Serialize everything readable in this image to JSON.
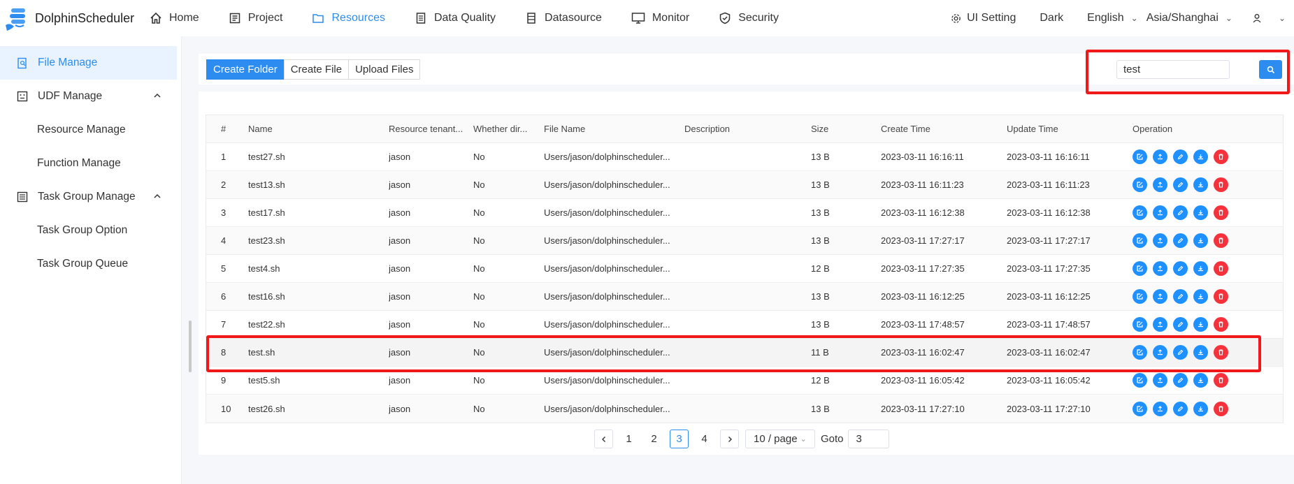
{
  "app": {
    "name": "DolphinScheduler"
  },
  "nav": {
    "items": [
      {
        "label": "Home",
        "icon": "home-icon"
      },
      {
        "label": "Project",
        "icon": "project-icon"
      },
      {
        "label": "Resources",
        "icon": "folder-icon",
        "active": true
      },
      {
        "label": "Data Quality",
        "icon": "data-quality-icon"
      },
      {
        "label": "Datasource",
        "icon": "datasource-icon"
      },
      {
        "label": "Monitor",
        "icon": "monitor-icon"
      },
      {
        "label": "Security",
        "icon": "shield-icon"
      }
    ],
    "right": {
      "ui_setting": "UI Setting",
      "theme": "Dark",
      "language": "English",
      "timezone": "Asia/Shanghai"
    }
  },
  "sidebar": {
    "items": [
      {
        "label": "File Manage",
        "icon": "file-search-icon"
      },
      {
        "label": "UDF Manage",
        "icon": "udf-icon"
      },
      {
        "label": "Resource Manage"
      },
      {
        "label": "Function Manage"
      },
      {
        "label": "Task Group Manage",
        "icon": "task-group-icon"
      },
      {
        "label": "Task Group Option"
      },
      {
        "label": "Task Group Queue"
      }
    ]
  },
  "toolbar": {
    "create_folder": "Create Folder",
    "create_file": "Create File",
    "upload_files": "Upload Files",
    "search_value": "test"
  },
  "table": {
    "columns": [
      "#",
      "Name",
      "Resource tenant...",
      "Whether dir...",
      "File Name",
      "Description",
      "Size",
      "Create Time",
      "Update Time",
      "Operation"
    ],
    "rows": [
      {
        "num": "1",
        "name": "test27.sh",
        "tenant": "jason",
        "dir": "No",
        "file": "Users/jason/dolphinscheduler...",
        "desc": "",
        "size": "13 B",
        "create": "2023-03-11 16:16:11",
        "update": "2023-03-11 16:16:11"
      },
      {
        "num": "2",
        "name": "test13.sh",
        "tenant": "jason",
        "dir": "No",
        "file": "Users/jason/dolphinscheduler...",
        "desc": "",
        "size": "13 B",
        "create": "2023-03-11 16:11:23",
        "update": "2023-03-11 16:11:23"
      },
      {
        "num": "3",
        "name": "test17.sh",
        "tenant": "jason",
        "dir": "No",
        "file": "Users/jason/dolphinscheduler...",
        "desc": "",
        "size": "13 B",
        "create": "2023-03-11 16:12:38",
        "update": "2023-03-11 16:12:38"
      },
      {
        "num": "4",
        "name": "test23.sh",
        "tenant": "jason",
        "dir": "No",
        "file": "Users/jason/dolphinscheduler...",
        "desc": "",
        "size": "13 B",
        "create": "2023-03-11 17:27:17",
        "update": "2023-03-11 17:27:17"
      },
      {
        "num": "5",
        "name": "test4.sh",
        "tenant": "jason",
        "dir": "No",
        "file": "Users/jason/dolphinscheduler...",
        "desc": "",
        "size": "12 B",
        "create": "2023-03-11 17:27:35",
        "update": "2023-03-11 17:27:35"
      },
      {
        "num": "6",
        "name": "test16.sh",
        "tenant": "jason",
        "dir": "No",
        "file": "Users/jason/dolphinscheduler...",
        "desc": "",
        "size": "13 B",
        "create": "2023-03-11 16:12:25",
        "update": "2023-03-11 16:12:25"
      },
      {
        "num": "7",
        "name": "test22.sh",
        "tenant": "jason",
        "dir": "No",
        "file": "Users/jason/dolphinscheduler...",
        "desc": "",
        "size": "13 B",
        "create": "2023-03-11 17:48:57",
        "update": "2023-03-11 17:48:57"
      },
      {
        "num": "8",
        "name": "test.sh",
        "tenant": "jason",
        "dir": "No",
        "file": "Users/jason/dolphinscheduler...",
        "desc": "",
        "size": "11 B",
        "create": "2023-03-11 16:02:47",
        "update": "2023-03-11 16:02:47"
      },
      {
        "num": "9",
        "name": "test5.sh",
        "tenant": "jason",
        "dir": "No",
        "file": "Users/jason/dolphinscheduler...",
        "desc": "",
        "size": "12 B",
        "create": "2023-03-11 16:05:42",
        "update": "2023-03-11 16:05:42"
      },
      {
        "num": "10",
        "name": "test26.sh",
        "tenant": "jason",
        "dir": "No",
        "file": "Users/jason/dolphinscheduler...",
        "desc": "",
        "size": "13 B",
        "create": "2023-03-11 17:27:10",
        "update": "2023-03-11 17:27:10"
      }
    ],
    "operations": [
      "edit-icon",
      "upload-icon",
      "rename-icon",
      "download-icon",
      "delete-icon"
    ]
  },
  "pagination": {
    "pages": [
      "1",
      "2",
      "3",
      "4"
    ],
    "current": "3",
    "page_size": "10 / page",
    "goto_label": "Goto",
    "goto_value": "3"
  },
  "colors": {
    "accent": "#2d8cf0",
    "danger": "#f5323c",
    "highlight": "#f01818"
  }
}
